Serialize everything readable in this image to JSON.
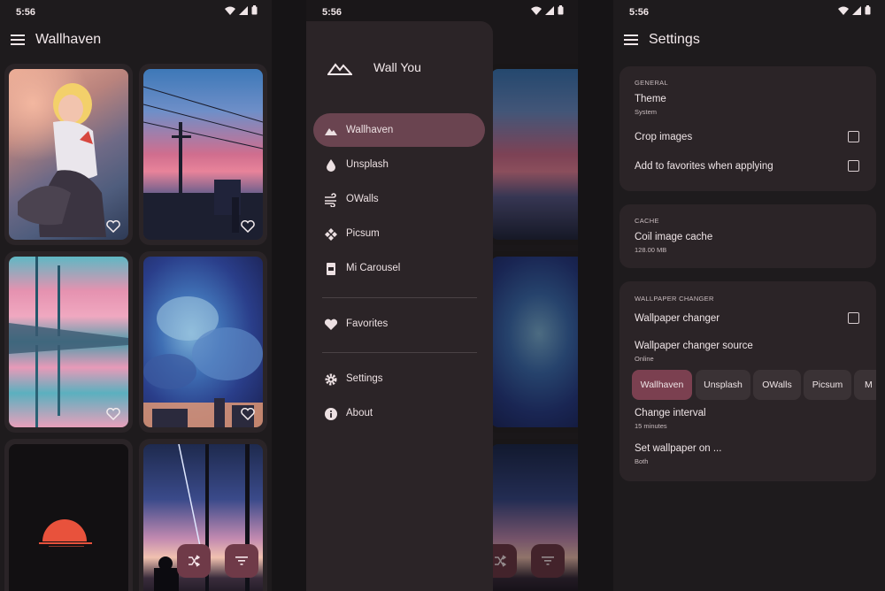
{
  "status": {
    "time": "5:56"
  },
  "wallhaven": {
    "title": "Wallhaven"
  },
  "drawer": {
    "app_name": "Wall You",
    "items": [
      {
        "label": "Wallhaven",
        "icon": "mountain-icon"
      },
      {
        "label": "Unsplash",
        "icon": "drop-icon"
      },
      {
        "label": "OWalls",
        "icon": "wind-icon"
      },
      {
        "label": "Picsum",
        "icon": "diamond-icon"
      },
      {
        "label": "Mi Carousel",
        "icon": "book-icon"
      },
      {
        "label": "Favorites",
        "icon": "heart-icon"
      },
      {
        "label": "Settings",
        "icon": "gear-icon"
      },
      {
        "label": "About",
        "icon": "info-icon"
      }
    ]
  },
  "settings": {
    "title": "Settings",
    "general": {
      "header": "GENERAL",
      "theme_title": "Theme",
      "theme_value": "System",
      "crop_label": "Crop images",
      "fav_label": "Add to favorites when applying"
    },
    "cache": {
      "header": "CACHE",
      "title": "Coil image cache",
      "value": "128.00 MB"
    },
    "changer": {
      "header": "WALLPAPER CHANGER",
      "changer_label": "Wallpaper changer",
      "source_title": "Wallpaper changer source",
      "source_value": "Online",
      "chips": [
        "Wallhaven",
        "Unsplash",
        "OWalls",
        "Picsum",
        "M"
      ],
      "interval_title": "Change interval",
      "interval_value": "15 minutes",
      "set_on_title": "Set wallpaper on ...",
      "set_on_value": "Both"
    }
  },
  "colors": {
    "accent": "#7b4050",
    "surface": "#2b2427",
    "background": "#1e1b1d"
  }
}
